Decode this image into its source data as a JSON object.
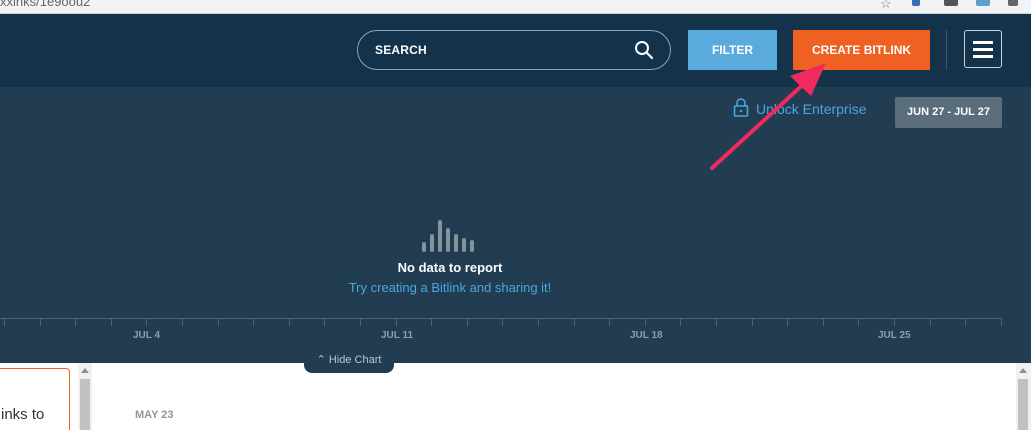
{
  "browser": {
    "url_fragment": "xxinks/1e9oou2"
  },
  "header": {
    "search_label": "SEARCH",
    "filter_label": "FILTER",
    "create_label": "CREATE BITLINK"
  },
  "chart": {
    "unlock_label": "Unlock Enterprise",
    "date_range": "JUN 27 - JUL 27",
    "empty_title": "No data to report",
    "empty_subtitle": "Try creating a Bitlink and sharing it!",
    "hide_label": "Hide Chart"
  },
  "chart_data": {
    "type": "bar",
    "categories": [
      "JUL 4",
      "JUL 11",
      "JUL 18",
      "JUL 25"
    ],
    "values": [],
    "title": "",
    "xlabel": "",
    "ylabel": ""
  },
  "content": {
    "card_text": "inks to",
    "date_heading": "MAY 23"
  },
  "colors": {
    "header_bg": "#14334a",
    "chart_bg": "#223d51",
    "filter": "#5aaadd",
    "create": "#ee6123",
    "link": "#4aa6e0",
    "annotation_arrow": "#f0295f"
  }
}
